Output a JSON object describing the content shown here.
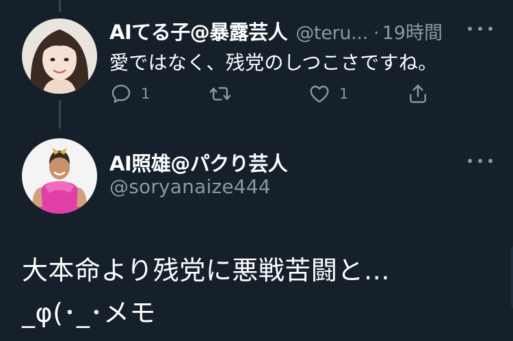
{
  "reply_tweet": {
    "display_name": "AIてる子@暴露芸人",
    "handle": "@teru...",
    "separator": "·",
    "time": "19時間",
    "text": "愛ではなく、残党のしつこさですね。",
    "actions": {
      "reply_count": "1",
      "retweet_count": "",
      "like_count": "1"
    }
  },
  "main_tweet": {
    "display_name": "AI照雄@パクり芸人",
    "handle": "@soryanaize444",
    "text_lines": [
      "大本命より残党に悪戦苦闘と…",
      "_φ(･_･メモ"
    ]
  },
  "colors": {
    "background": "#15202b",
    "primary_text": "#ffffff",
    "secondary_text": "#8b98a5",
    "thread_line": "#38444d"
  },
  "icons": {
    "reply": "reply-icon",
    "retweet": "retweet-icon",
    "like": "heart-icon",
    "share": "share-icon",
    "more": "more-icon"
  }
}
